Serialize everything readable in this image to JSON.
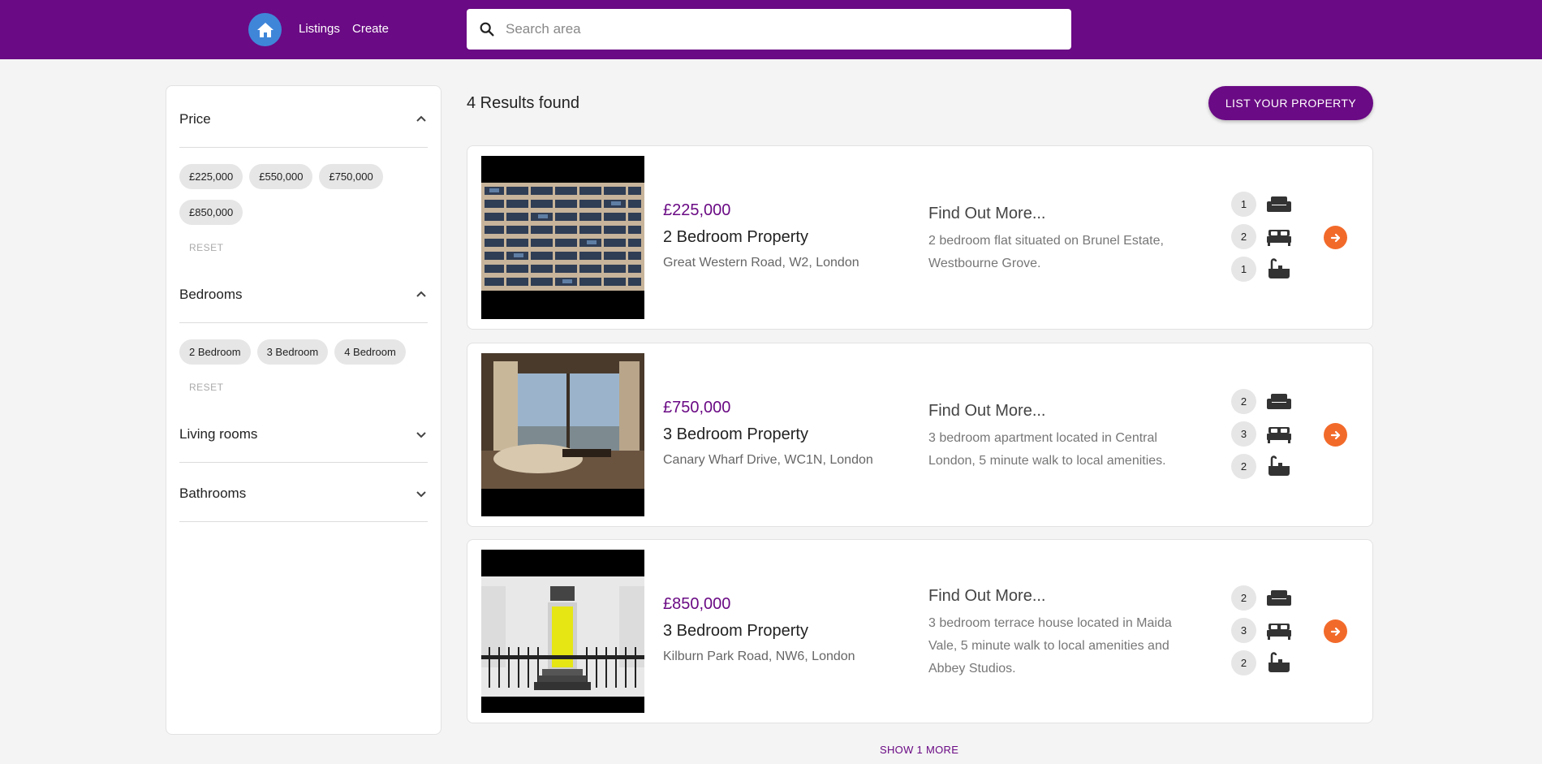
{
  "nav": {
    "links": [
      "Listings",
      "Create"
    ],
    "search_placeholder": "Search area",
    "brand_color": "#6a0a84",
    "home_color": "#3f86d9"
  },
  "filters": {
    "price": {
      "label": "Price",
      "options": [
        "£225,000",
        "£550,000",
        "£750,000",
        "£850,000"
      ],
      "reset": "RESET",
      "expanded": true
    },
    "bedrooms": {
      "label": "Bedrooms",
      "options": [
        "2 Bedroom",
        "3 Bedroom",
        "4 Bedroom"
      ],
      "reset": "RESET",
      "expanded": true
    },
    "living_rooms": {
      "label": "Living rooms",
      "expanded": false
    },
    "bathrooms": {
      "label": "Bathrooms",
      "expanded": false
    }
  },
  "results": {
    "count_label": "4 Results found",
    "list_button": "LIST YOUR PROPERTY",
    "show_more": "SHOW 1 MORE",
    "accent_color": "#f26a2a",
    "listings": [
      {
        "price": "£225,000",
        "title": "2 Bedroom Property",
        "address": "Great Western Road, W2, London",
        "more": "Find Out More...",
        "description": "2 bedroom flat situated on Brunel Estate, Westbourne Grove.",
        "living_rooms": "1",
        "bedrooms": "2",
        "bathrooms": "1"
      },
      {
        "price": "£750,000",
        "title": "3 Bedroom Property",
        "address": "Canary Wharf Drive, WC1N, London",
        "more": "Find Out More...",
        "description": "3 bedroom apartment located in Central London, 5 minute walk to local amenities.",
        "living_rooms": "2",
        "bedrooms": "3",
        "bathrooms": "2"
      },
      {
        "price": "£850,000",
        "title": "3 Bedroom Property",
        "address": "Kilburn Park Road, NW6, London",
        "more": "Find Out More...",
        "description": "3 bedroom terrace house located in Maida Vale, 5 minute walk to local amenities and Abbey Studios.",
        "living_rooms": "2",
        "bedrooms": "3",
        "bathrooms": "2"
      }
    ]
  }
}
